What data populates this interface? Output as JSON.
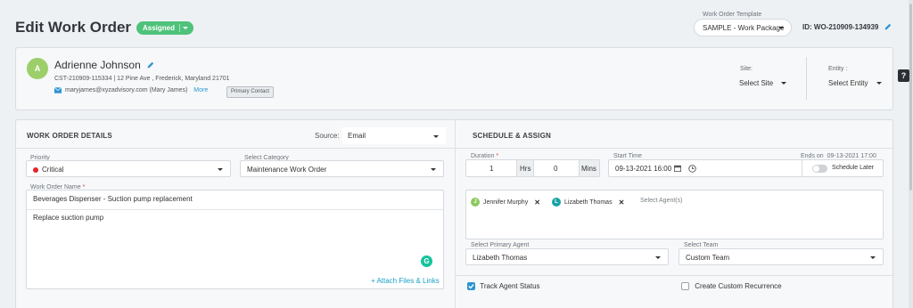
{
  "header": {
    "title": "Edit Work Order",
    "status": "Assigned",
    "template_label": "Work Order Template",
    "template_value": "SAMPLE - Work Package",
    "work_order_id": "ID: WO-210909-134939",
    "help": "?"
  },
  "contact": {
    "initial": "A",
    "name": "Adrienne Johnson",
    "address": "CST-210909-115334 | 12 Pine Ave , Frederick, Maryland 21701",
    "email": "maryjames@xyzadvisory.com (Mary James)",
    "more": "More",
    "tag": "Primary Contact",
    "site_label": "Site:",
    "site_value": "Select Site",
    "entity_label": "Entity :",
    "entity_value": "Select Entity"
  },
  "details": {
    "heading": "WORK ORDER DETAILS",
    "source_label": "Source:",
    "source_value": "Email",
    "priority_label": "Priority",
    "priority_value": "Critical",
    "category_label": "Select Category",
    "category_value": "Maintenance Work Order",
    "name_label": "Work Order Name",
    "name_value": "Beverages Dispenser - Suction pump replacement",
    "description": "Replace suction pump",
    "attach": "+ Attach Files & Links",
    "grammarly": "G"
  },
  "schedule": {
    "heading": "SCHEDULE & ASSIGN",
    "duration_label": "Duration",
    "hours": "1",
    "hrs_unit": "Hrs",
    "mins": "0",
    "mins_unit": "Mins",
    "start_label": "Start Time",
    "start_value": "09-13-2021 16:00",
    "ends_label": "Ends on",
    "ends_value": "09-13-2021 17:00",
    "schedule_later": "Schedule Later",
    "agents": [
      {
        "initial": "J",
        "name": "Jennifer Murphy",
        "color": "#8ac85d"
      },
      {
        "initial": "L",
        "name": "Lizabeth Thomas",
        "color": "#17a2a6"
      }
    ],
    "agents_placeholder": "Select Agent(s)",
    "primary_label": "Select Primary Agent",
    "primary_value": "Lizabeth Thomas",
    "team_label": "Select Team",
    "team_value": "Custom Team",
    "track_status": "Track Agent Status",
    "track_checked": true,
    "custom_recurrence": "Create Custom Recurrence",
    "custom_checked": false
  },
  "colors": {
    "accent": "#2a95d1",
    "status_green": "#4fc27a",
    "critical_red": "#e4242a"
  }
}
